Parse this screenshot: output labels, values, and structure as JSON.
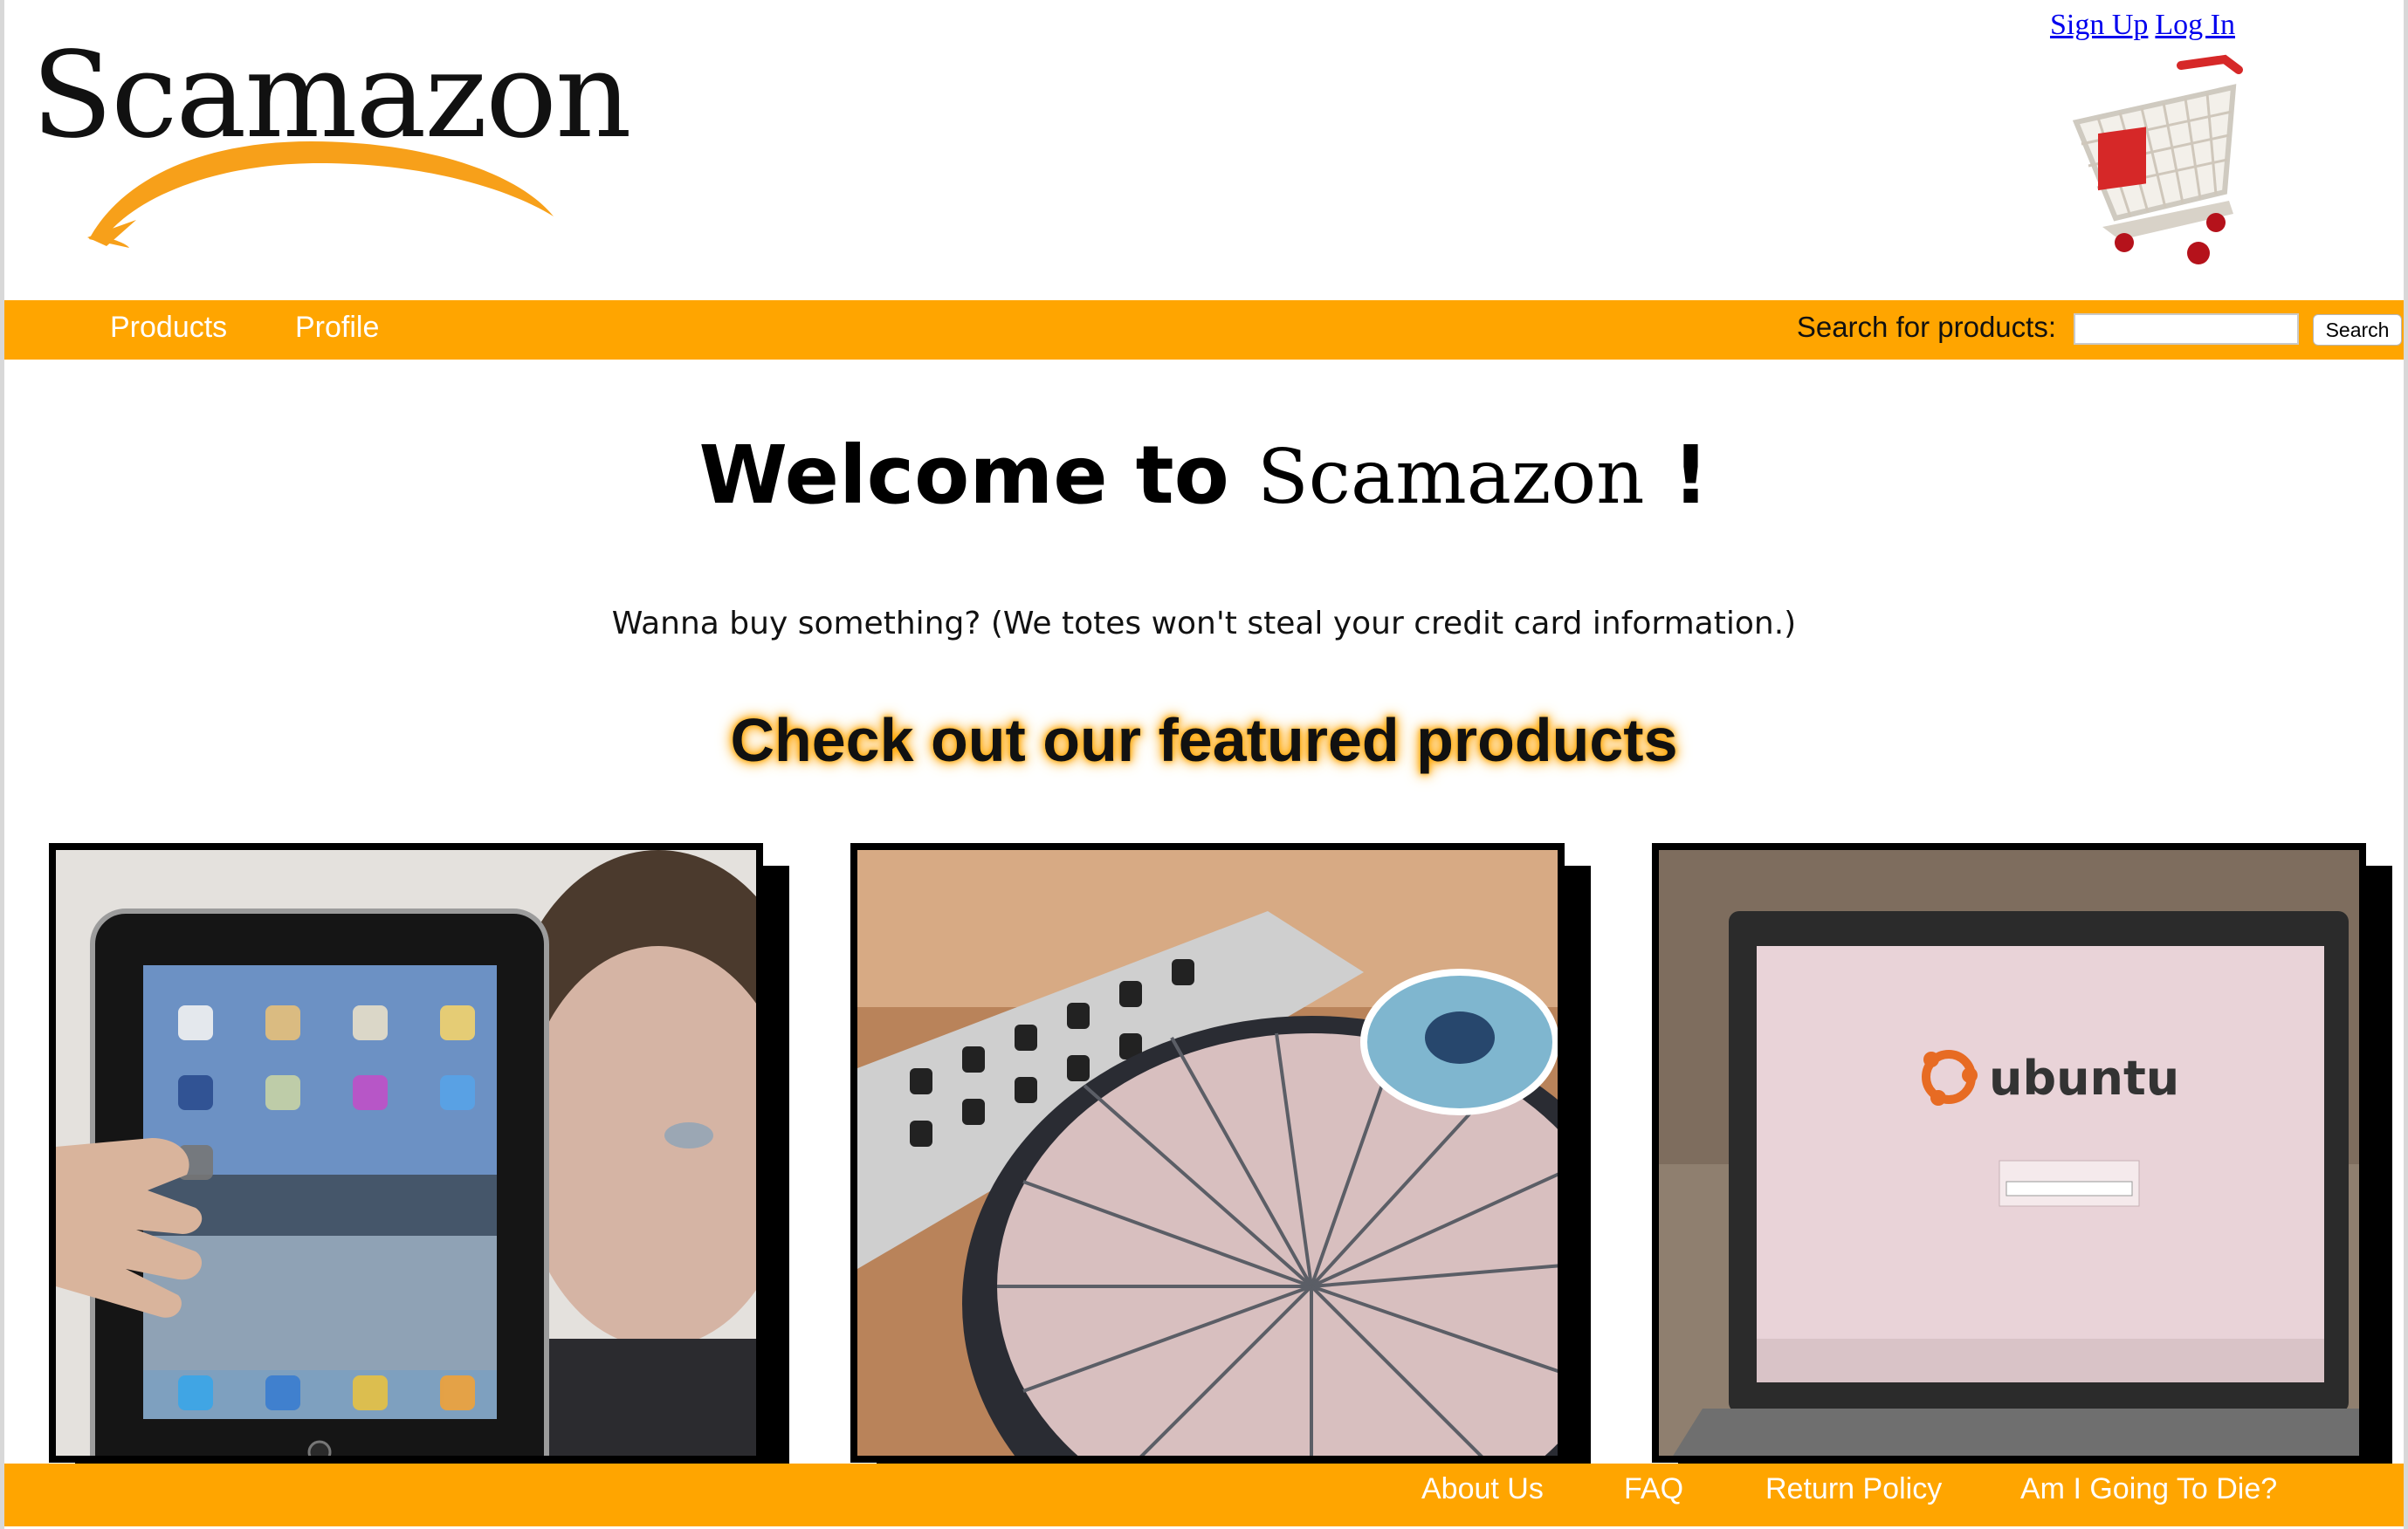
{
  "header": {
    "logo_text": "Scamazon",
    "auth": {
      "signup": "Sign Up",
      "login": "Log In"
    },
    "cart_icon": "shopping-cart-icon"
  },
  "nav": {
    "items": [
      "Products",
      "Profile"
    ],
    "search_label": "Search for products:",
    "search_value": "",
    "search_button": "Search"
  },
  "main": {
    "welcome_prefix": "Welcome to ",
    "brand": "Scamazon",
    "welcome_suffix": " !",
    "subtitle": "Wanna buy something? (We totes won't steal your credit card information.)",
    "featured_heading": "Check out our featured products",
    "products": [
      {
        "image": "tablet-image"
      },
      {
        "image": "turntable-image"
      },
      {
        "image": "ubuntu-laptop-image",
        "screen_text": "ubuntu"
      }
    ]
  },
  "footer": {
    "links": [
      "About Us",
      "FAQ",
      "Return Policy",
      "Am I Going To Die?"
    ]
  },
  "colors": {
    "accent": "#ffa500",
    "link": "#0000ee",
    "text": "#111111",
    "background": "#ffffff"
  }
}
